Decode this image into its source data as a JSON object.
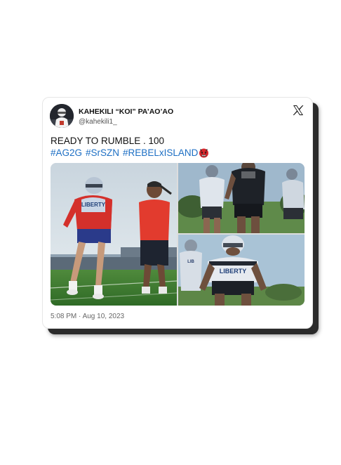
{
  "tweet": {
    "display_name": "KAHEKILI “KOI” PA’AO’AO",
    "handle": "@kahekili1_",
    "text": "READY TO RUMBLE . 100",
    "hashtags": [
      "#AG2G",
      "#SrSZN",
      "#REBELxISLAND"
    ],
    "emoji": "angry-face-emoji",
    "timestamp": "5:08 PM · Aug 10, 2023",
    "platform_icon": "x-logo-icon"
  },
  "media": {
    "photos": [
      {
        "name": "photo-training-field",
        "jersey_text": "LIBERTY"
      },
      {
        "name": "photo-players-lineup",
        "jersey_text": ""
      },
      {
        "name": "photo-lineman-stance",
        "jersey_text": "LIBERTY"
      }
    ]
  },
  "colors": {
    "hashtag": "#1d6fc4",
    "text": "#111111",
    "muted": "#666666",
    "card_shadow": "#2b2b2b"
  }
}
